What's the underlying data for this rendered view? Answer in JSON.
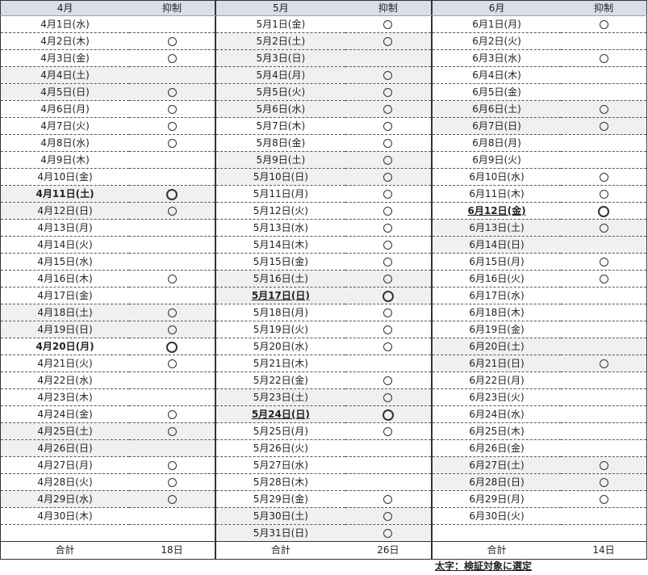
{
  "months": [
    {
      "key": "apr",
      "header": {
        "month": "4月",
        "col": "抑制"
      },
      "rows": [
        {
          "date": "4月1日(水)",
          "mark": false,
          "bold": false,
          "shade": false
        },
        {
          "date": "4月2日(木)",
          "mark": true,
          "bold": false,
          "shade": false
        },
        {
          "date": "4月3日(金)",
          "mark": true,
          "bold": false,
          "shade": false
        },
        {
          "date": "4月4日(土)",
          "mark": false,
          "bold": false,
          "shade": true
        },
        {
          "date": "4月5日(日)",
          "mark": true,
          "bold": false,
          "shade": true
        },
        {
          "date": "4月6日(月)",
          "mark": true,
          "bold": false,
          "shade": false
        },
        {
          "date": "4月7日(火)",
          "mark": true,
          "bold": false,
          "shade": false
        },
        {
          "date": "4月8日(水)",
          "mark": true,
          "bold": false,
          "shade": false
        },
        {
          "date": "4月9日(木)",
          "mark": false,
          "bold": false,
          "shade": false
        },
        {
          "date": "4月10日(金)",
          "mark": false,
          "bold": false,
          "shade": false
        },
        {
          "date": "4月11日(土)",
          "mark": true,
          "bold": true,
          "shade": true
        },
        {
          "date": "4月12日(日)",
          "mark": true,
          "bold": false,
          "shade": true
        },
        {
          "date": "4月13日(月)",
          "mark": false,
          "bold": false,
          "shade": false
        },
        {
          "date": "4月14日(火)",
          "mark": false,
          "bold": false,
          "shade": false
        },
        {
          "date": "4月15日(水)",
          "mark": false,
          "bold": false,
          "shade": false
        },
        {
          "date": "4月16日(木)",
          "mark": true,
          "bold": false,
          "shade": false
        },
        {
          "date": "4月17日(金)",
          "mark": false,
          "bold": false,
          "shade": false
        },
        {
          "date": "4月18日(土)",
          "mark": true,
          "bold": false,
          "shade": true
        },
        {
          "date": "4月19日(日)",
          "mark": true,
          "bold": false,
          "shade": true
        },
        {
          "date": "4月20日(月)",
          "mark": true,
          "bold": true,
          "shade": false
        },
        {
          "date": "4月21日(火)",
          "mark": true,
          "bold": false,
          "shade": false
        },
        {
          "date": "4月22日(水)",
          "mark": false,
          "bold": false,
          "shade": false
        },
        {
          "date": "4月23日(木)",
          "mark": false,
          "bold": false,
          "shade": false
        },
        {
          "date": "4月24日(金)",
          "mark": true,
          "bold": false,
          "shade": false
        },
        {
          "date": "4月25日(土)",
          "mark": true,
          "bold": false,
          "shade": true
        },
        {
          "date": "4月26日(日)",
          "mark": false,
          "bold": false,
          "shade": true
        },
        {
          "date": "4月27日(月)",
          "mark": true,
          "bold": false,
          "shade": false
        },
        {
          "date": "4月28日(火)",
          "mark": true,
          "bold": false,
          "shade": false
        },
        {
          "date": "4月29日(水)",
          "mark": true,
          "bold": false,
          "shade": true
        },
        {
          "date": "4月30日(木)",
          "mark": false,
          "bold": false,
          "shade": false
        }
      ],
      "total": {
        "label": "合計",
        "value": "18日"
      }
    },
    {
      "key": "may",
      "header": {
        "month": "5月",
        "col": "抑制"
      },
      "rows": [
        {
          "date": "5月1日(金)",
          "mark": true,
          "bold": false,
          "shade": false
        },
        {
          "date": "5月2日(土)",
          "mark": true,
          "bold": false,
          "shade": true
        },
        {
          "date": "5月3日(日)",
          "mark": false,
          "bold": false,
          "shade": true
        },
        {
          "date": "5月4日(月)",
          "mark": true,
          "bold": false,
          "shade": true
        },
        {
          "date": "5月5日(火)",
          "mark": true,
          "bold": false,
          "shade": true
        },
        {
          "date": "5月6日(水)",
          "mark": true,
          "bold": false,
          "shade": true
        },
        {
          "date": "5月7日(木)",
          "mark": true,
          "bold": false,
          "shade": false
        },
        {
          "date": "5月8日(金)",
          "mark": true,
          "bold": false,
          "shade": false
        },
        {
          "date": "5月9日(土)",
          "mark": true,
          "bold": false,
          "shade": true
        },
        {
          "date": "5月10日(日)",
          "mark": true,
          "bold": false,
          "shade": true
        },
        {
          "date": "5月11日(月)",
          "mark": true,
          "bold": false,
          "shade": false
        },
        {
          "date": "5月12日(火)",
          "mark": true,
          "bold": false,
          "shade": false
        },
        {
          "date": "5月13日(水)",
          "mark": true,
          "bold": false,
          "shade": false
        },
        {
          "date": "5月14日(木)",
          "mark": true,
          "bold": false,
          "shade": false
        },
        {
          "date": "5月15日(金)",
          "mark": true,
          "bold": false,
          "shade": false
        },
        {
          "date": "5月16日(土)",
          "mark": true,
          "bold": false,
          "shade": true
        },
        {
          "date": "5月17日(日)",
          "mark": true,
          "bold": true,
          "uline": true,
          "shade": true
        },
        {
          "date": "5月18日(月)",
          "mark": true,
          "bold": false,
          "shade": false
        },
        {
          "date": "5月19日(火)",
          "mark": true,
          "bold": false,
          "shade": false
        },
        {
          "date": "5月20日(水)",
          "mark": true,
          "bold": false,
          "shade": false
        },
        {
          "date": "5月21日(木)",
          "mark": false,
          "bold": false,
          "shade": false
        },
        {
          "date": "5月22日(金)",
          "mark": true,
          "bold": false,
          "shade": false
        },
        {
          "date": "5月23日(土)",
          "mark": true,
          "bold": false,
          "shade": true
        },
        {
          "date": "5月24日(日)",
          "mark": true,
          "bold": true,
          "uline": true,
          "shade": true
        },
        {
          "date": "5月25日(月)",
          "mark": true,
          "bold": false,
          "shade": false
        },
        {
          "date": "5月26日(火)",
          "mark": false,
          "bold": false,
          "shade": false
        },
        {
          "date": "5月27日(水)",
          "mark": false,
          "bold": false,
          "shade": false
        },
        {
          "date": "5月28日(木)",
          "mark": false,
          "bold": false,
          "shade": false
        },
        {
          "date": "5月29日(金)",
          "mark": true,
          "bold": false,
          "shade": false
        },
        {
          "date": "5月30日(土)",
          "mark": true,
          "bold": false,
          "shade": true
        },
        {
          "date": "5月31日(日)",
          "mark": true,
          "bold": false,
          "shade": true
        }
      ],
      "total": {
        "label": "合計",
        "value": "26日"
      }
    },
    {
      "key": "jun",
      "header": {
        "month": "6月",
        "col": "抑制"
      },
      "rows": [
        {
          "date": "6月1日(月)",
          "mark": true,
          "bold": false,
          "shade": false
        },
        {
          "date": "6月2日(火)",
          "mark": false,
          "bold": false,
          "shade": false
        },
        {
          "date": "6月3日(水)",
          "mark": true,
          "bold": false,
          "shade": false
        },
        {
          "date": "6月4日(木)",
          "mark": false,
          "bold": false,
          "shade": false
        },
        {
          "date": "6月5日(金)",
          "mark": false,
          "bold": false,
          "shade": false
        },
        {
          "date": "6月6日(土)",
          "mark": true,
          "bold": false,
          "shade": true
        },
        {
          "date": "6月7日(日)",
          "mark": true,
          "bold": false,
          "shade": true
        },
        {
          "date": "6月8日(月)",
          "mark": false,
          "bold": false,
          "shade": false
        },
        {
          "date": "6月9日(火)",
          "mark": false,
          "bold": false,
          "shade": false
        },
        {
          "date": "6月10日(水)",
          "mark": true,
          "bold": false,
          "shade": false
        },
        {
          "date": "6月11日(木)",
          "mark": true,
          "bold": false,
          "shade": false
        },
        {
          "date": "6月12日(金)",
          "mark": true,
          "bold": true,
          "uline": true,
          "shade": false
        },
        {
          "date": "6月13日(土)",
          "mark": true,
          "bold": false,
          "shade": true
        },
        {
          "date": "6月14日(日)",
          "mark": false,
          "bold": false,
          "shade": true
        },
        {
          "date": "6月15日(月)",
          "mark": true,
          "bold": false,
          "shade": false
        },
        {
          "date": "6月16日(火)",
          "mark": true,
          "bold": false,
          "shade": false
        },
        {
          "date": "6月17日(水)",
          "mark": false,
          "bold": false,
          "shade": false
        },
        {
          "date": "6月18日(木)",
          "mark": false,
          "bold": false,
          "shade": false
        },
        {
          "date": "6月19日(金)",
          "mark": false,
          "bold": false,
          "shade": false
        },
        {
          "date": "6月20日(土)",
          "mark": false,
          "bold": false,
          "shade": true
        },
        {
          "date": "6月21日(日)",
          "mark": true,
          "bold": false,
          "shade": true
        },
        {
          "date": "6月22日(月)",
          "mark": false,
          "bold": false,
          "shade": false
        },
        {
          "date": "6月23日(火)",
          "mark": false,
          "bold": false,
          "shade": false
        },
        {
          "date": "6月24日(水)",
          "mark": false,
          "bold": false,
          "shade": false
        },
        {
          "date": "6月25日(木)",
          "mark": false,
          "bold": false,
          "shade": false
        },
        {
          "date": "6月26日(金)",
          "mark": false,
          "bold": false,
          "shade": false
        },
        {
          "date": "6月27日(土)",
          "mark": true,
          "bold": false,
          "shade": true
        },
        {
          "date": "6月28日(日)",
          "mark": true,
          "bold": false,
          "shade": true
        },
        {
          "date": "6月29日(月)",
          "mark": true,
          "bold": false,
          "shade": false
        },
        {
          "date": "6月30日(火)",
          "mark": false,
          "bold": false,
          "shade": false
        }
      ],
      "total": {
        "label": "合計",
        "value": "14日"
      }
    }
  ],
  "legend": "太字：検証対象に選定",
  "colors": {
    "header_bg": "#d9dee8",
    "weekend_bg": "#f0f0f0"
  }
}
